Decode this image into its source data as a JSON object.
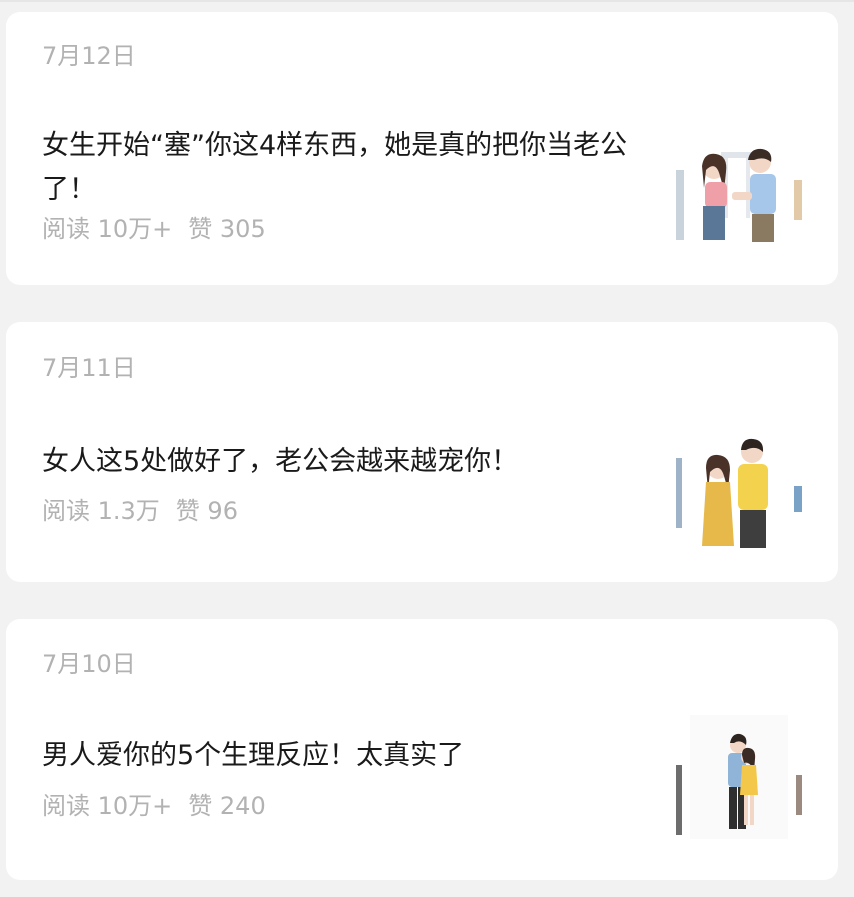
{
  "articles": [
    {
      "date": "7月12日",
      "title": "女生开始“塞”你这4样东西，她是真的把你当老公了！",
      "reads": "阅读 10万+",
      "likes": "赞 305"
    },
    {
      "date": "7月11日",
      "title": "女人这5处做好了，老公会越来越宠你！",
      "reads": "阅读 1.3万",
      "likes": "赞 96"
    },
    {
      "date": "7月10日",
      "title": "男人爱你的5个生理反应！太真实了",
      "reads": "阅读 10万+",
      "likes": "赞 240"
    }
  ],
  "colors": {
    "page_bg": "#f2f2f2",
    "card_bg": "#ffffff",
    "title_text": "#1a1a1a",
    "meta_text": "#b2b2b2"
  },
  "icons": {
    "article_0_thumb": "couple-pink-blue-illustration",
    "article_1_thumb": "couple-yellow-illustration",
    "article_2_thumb": "couple-hug-illustration"
  }
}
